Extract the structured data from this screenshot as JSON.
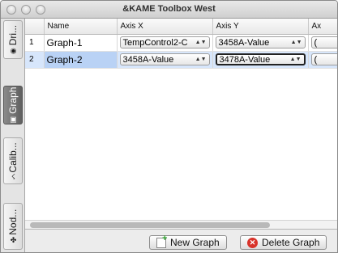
{
  "window": {
    "title": "&KAME Toolbox West"
  },
  "tabs": [
    {
      "label": "Dri...",
      "icon": "driver-icon"
    },
    {
      "label": "Graph",
      "icon": "graph-icon"
    },
    {
      "label": "Calib...",
      "icon": "calibration-icon"
    },
    {
      "label": "Nod...",
      "icon": "nodes-icon"
    }
  ],
  "table": {
    "columns": [
      "",
      "Name",
      "Axis X",
      "Axis Y",
      "Ax"
    ],
    "rows": [
      {
        "no": "1",
        "name": "Graph-1",
        "axis_x": "TempControl2-C",
        "axis_y": "3458A-Value",
        "axis_z": "("
      },
      {
        "no": "2",
        "name": "Graph-2",
        "axis_x": "3458A-Value",
        "axis_y": "3478A-Value",
        "axis_z": "("
      }
    ]
  },
  "buttons": {
    "new_graph": "New Graph",
    "delete_graph": "Delete Graph"
  }
}
